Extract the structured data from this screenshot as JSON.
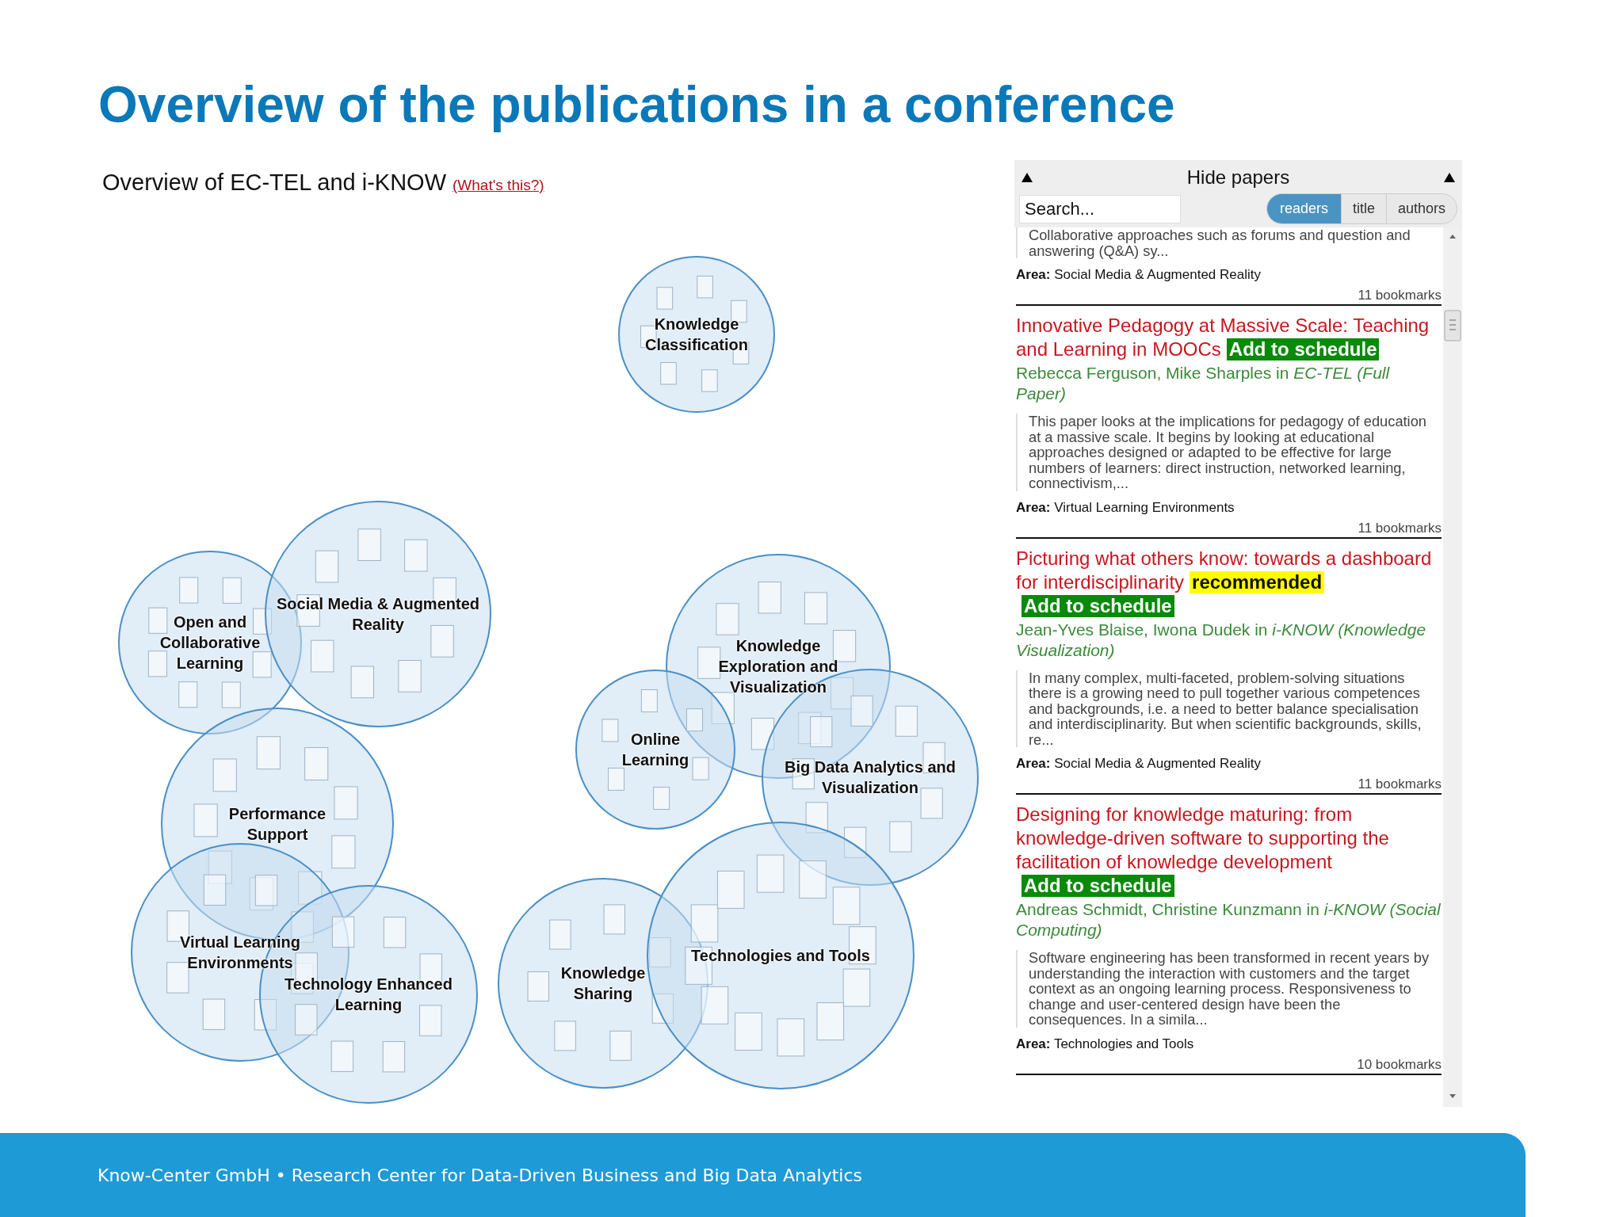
{
  "slide_title": "Overview of the publications in a conference",
  "overview": {
    "heading": "Overview of EC-TEL and i-KNOW",
    "help_link": "(What's this?)",
    "clusters": [
      {
        "label": "Knowledge Classification"
      },
      {
        "label": "Open and Collaborative Learning"
      },
      {
        "label": "Social Media & Augmented Reality"
      },
      {
        "label": "Performance Support"
      },
      {
        "label": "Virtual Learning Environments"
      },
      {
        "label": "Technology Enhanced Learning"
      },
      {
        "label": "Knowledge Exploration and Visualization"
      },
      {
        "label": "Online Learning"
      },
      {
        "label": "Big Data Analytics and Visualization"
      },
      {
        "label": "Knowledge Sharing"
      },
      {
        "label": "Technologies and Tools"
      }
    ]
  },
  "papers_panel": {
    "toggle": "Hide papers",
    "search": {
      "placeholder": "Search..."
    },
    "sort_tabs": [
      {
        "label": "readers",
        "selected": true
      },
      {
        "label": "title",
        "selected": false
      },
      {
        "label": "authors",
        "selected": false
      }
    ],
    "papers": [
      {
        "abstract": "Collaborative approaches such as forums and question and answering (Q&A) sy...",
        "area": "**Area:** Social Media & Augmented Reality",
        "bookmarks": "11 bookmarks"
      },
      {
        "title": "Innovative Pedagogy at Massive Scale: Teaching and Learning in MOOCs",
        "badges": [
          {
            "kind": "schedule",
            "text": "Add to schedule"
          }
        ],
        "source": "Rebecca Ferguson, Mike Sharples in *EC-TEL (Full Paper)*",
        "abstract": "This paper looks at the implications for pedagogy of education at a massive scale. It begins by looking at educational approaches designed or adapted to be effective for large numbers of learners: direct instruction, networked learning, connectivism,...",
        "area": "**Area:** Virtual Learning Environments",
        "bookmarks": "11 bookmarks"
      },
      {
        "title": "Picturing what others know: towards a dashboard for interdisciplinarity",
        "badges": [
          {
            "kind": "recommended",
            "text": "recommended"
          },
          {
            "kind": "schedule",
            "text": "Add to schedule"
          }
        ],
        "source": "Jean-Yves Blaise, Iwona Dudek in *i-KNOW (Knowledge Visualization)*",
        "abstract": "In many complex, multi-faceted, problem-solving situations there is a growing need to pull together various competences and backgrounds, i.e. a need to better balance specialisation and interdisciplinarity. But when scientific backgrounds, skills, re...",
        "area": "**Area:** Social Media & Augmented Reality",
        "bookmarks": "11 bookmarks"
      },
      {
        "title": "Designing for knowledge maturing: from knowledge-driven software to supporting the facilitation of knowledge development",
        "badges": [
          {
            "kind": "schedule",
            "text": "Add to schedule"
          }
        ],
        "source": "Andreas Schmidt, Christine Kunzmann in *i-KNOW (Social Computing)*",
        "abstract": "Software engineering has been transformed in recent years by understanding the interaction with customers and the target context as an ongoing learning process. Responsiveness to change and user-centered design have been the consequences. In a simila...",
        "area": "**Area:** Technologies and Tools",
        "bookmarks": "10 bookmarks"
      }
    ]
  },
  "footer": "Know-Center GmbH • Research Center for Data-Driven Business and Big Data Analytics"
}
